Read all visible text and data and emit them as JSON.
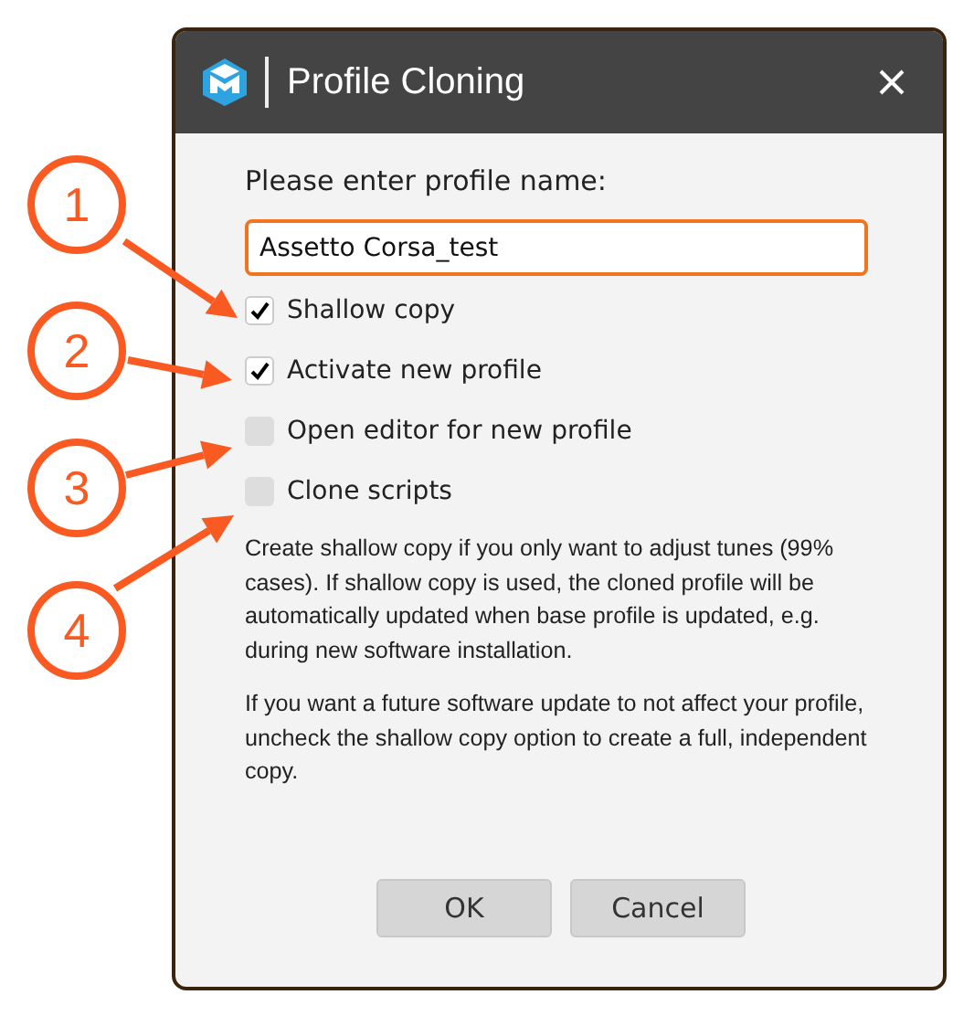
{
  "window": {
    "title": "Profile Cloning"
  },
  "prompt": "Please enter profile name:",
  "name_field": {
    "value": "Assetto Corsa_test"
  },
  "options": [
    {
      "label": "Shallow copy",
      "checked": true
    },
    {
      "label": "Activate new profile",
      "checked": true
    },
    {
      "label": "Open editor for new profile",
      "checked": false
    },
    {
      "label": "Clone scripts",
      "checked": false
    }
  ],
  "notes": [
    "Create shallow copy if you only want to adjust tunes (99% cases). If shallow copy is used, the cloned profile will be automatically updated when base profile is updated, e.g. during new software installation.",
    "If you want a future software update to not affect your profile, uncheck the shallow copy option to create a full, independent copy."
  ],
  "buttons": [
    "OK",
    "Cancel"
  ],
  "callouts": [
    "1",
    "2",
    "3",
    "4"
  ]
}
